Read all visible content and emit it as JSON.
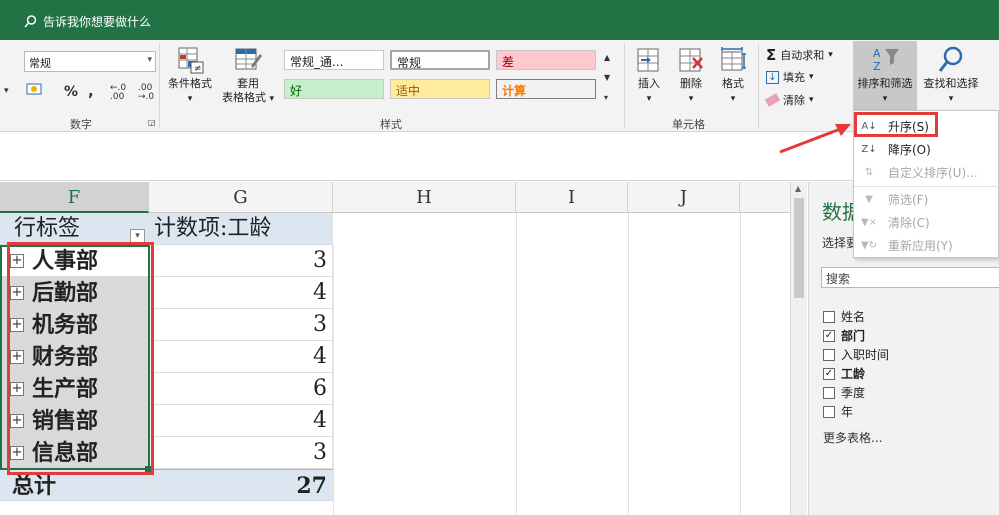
{
  "tellme": "告诉我你想要做什么",
  "ribbon": {
    "number_format": "常规",
    "percent_sym": "%",
    "comma_sym": ",",
    "inc_dec": ".00\n→.0",
    "number_group": "数字",
    "cond_format": "条件格式",
    "table_format_1": "套用",
    "table_format_2": "表格格式",
    "style_group": "样式",
    "styles": {
      "normal_2": "常规_通...",
      "normal": "常规",
      "bad": "差",
      "good": "好",
      "neutral": "适中",
      "calc": "计算"
    },
    "insert": "插入",
    "delete": "删除",
    "format": "格式",
    "cells_group": "单元格",
    "autosum": "自动求和",
    "fill": "填充",
    "clear": "清除",
    "sort_filter": "排序和筛选",
    "find_select": "查找和选择"
  },
  "sort_menu": {
    "asc": "升序(S)",
    "desc": "降序(O)",
    "custom": "自定义排序(U)...",
    "filter": "筛选(F)",
    "clear": "清除(C)",
    "reapply": "重新应用(Y)"
  },
  "columns": [
    "F",
    "G",
    "H",
    "I",
    "J"
  ],
  "pivot": {
    "row_label_header": "行标签",
    "value_header": "计数项:工龄",
    "rows": [
      {
        "dept": "人事部",
        "count": "3"
      },
      {
        "dept": "后勤部",
        "count": "4"
      },
      {
        "dept": "机务部",
        "count": "3"
      },
      {
        "dept": "财务部",
        "count": "4"
      },
      {
        "dept": "生产部",
        "count": "6"
      },
      {
        "dept": "销售部",
        "count": "4"
      },
      {
        "dept": "信息部",
        "count": "3"
      }
    ],
    "total_label": "总计",
    "total_value": "27"
  },
  "pane": {
    "title": "数据",
    "subtitle": "选择要",
    "search_placeholder": "搜索",
    "fields": [
      {
        "name": "姓名",
        "checked": false
      },
      {
        "name": "部门",
        "checked": true
      },
      {
        "name": "入职时间",
        "checked": false
      },
      {
        "name": "工龄",
        "checked": true
      },
      {
        "name": "季度",
        "checked": false
      },
      {
        "name": "年",
        "checked": false
      }
    ],
    "more": "更多表格..."
  },
  "colors": {
    "excel_green": "#217346",
    "highlight_red": "#e33a3a",
    "pivot_header": "#dce6f1"
  }
}
